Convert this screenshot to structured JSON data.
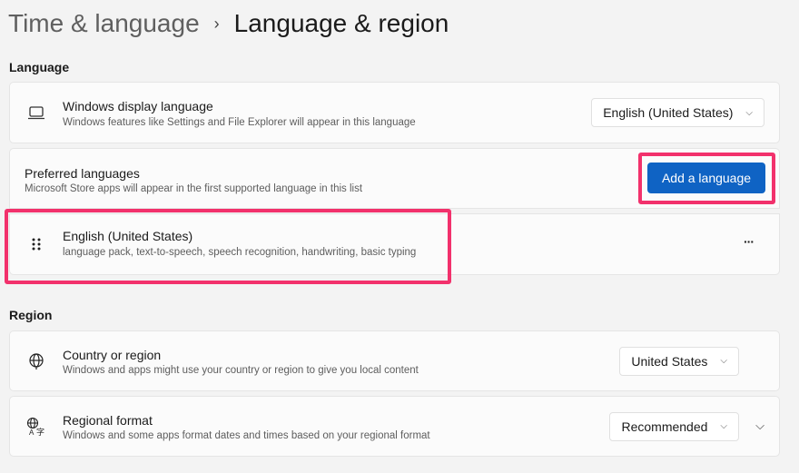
{
  "breadcrumb": {
    "parent": "Time & language",
    "separator": "›",
    "current": "Language & region"
  },
  "language_section": {
    "label": "Language",
    "display_language": {
      "title": "Windows display language",
      "subtitle": "Windows features like Settings and File Explorer will appear in this language",
      "value": "English (United States)"
    },
    "preferred": {
      "title": "Preferred languages",
      "subtitle": "Microsoft Store apps will appear in the first supported language in this list",
      "add_button": "Add a language"
    },
    "installed": [
      {
        "title": "English (United States)",
        "subtitle": "language pack, text-to-speech, speech recognition, handwriting, basic typing",
        "more": "···"
      }
    ]
  },
  "region_section": {
    "label": "Region",
    "country": {
      "title": "Country or region",
      "subtitle": "Windows and apps might use your country or region to give you local content",
      "value": "United States"
    },
    "format": {
      "title": "Regional format",
      "subtitle": "Windows and some apps format dates and times based on your regional format",
      "value": "Recommended"
    }
  },
  "colors": {
    "accent": "#0f63c4",
    "highlight": "#f2316c"
  }
}
